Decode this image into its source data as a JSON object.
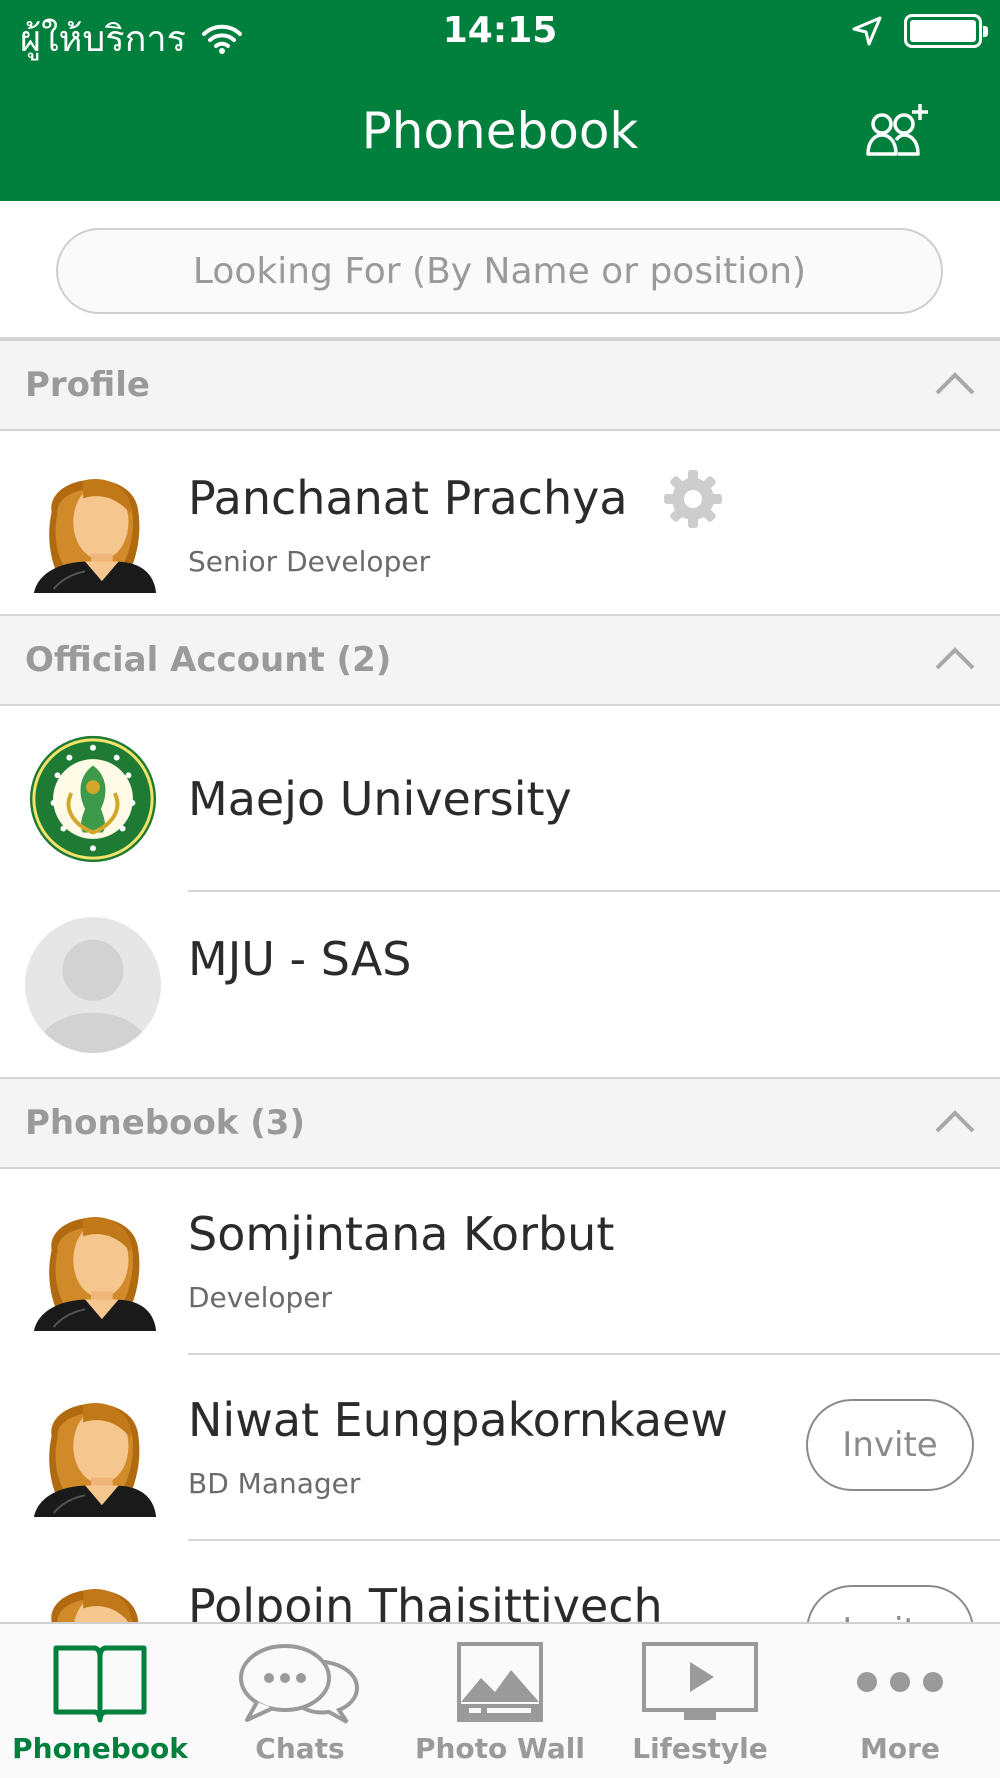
{
  "status_bar": {
    "carrier": "ผู้ให้บริการ",
    "time": "14:15"
  },
  "nav": {
    "title": "Phonebook",
    "add_contact_icon": "add-contact-icon"
  },
  "search": {
    "placeholder": "Looking For (By Name or position)"
  },
  "sections": {
    "profile": {
      "title": "Profile"
    },
    "official": {
      "title": "Official Account (2)"
    },
    "phonebook": {
      "title": "Phonebook (3)"
    }
  },
  "profile": {
    "name": "Panchanat Prachya",
    "position": "Senior Developer"
  },
  "official_accounts": [
    {
      "name": "Maejo University"
    },
    {
      "name": "MJU - SAS"
    }
  ],
  "contacts": [
    {
      "name": "Somjintana Korbut",
      "position": "Developer"
    },
    {
      "name": "Niwat Eungpakornkaew",
      "position": "BD Manager",
      "action": "Invite"
    },
    {
      "name": "Polpoin Thaisittivech",
      "action": "Invite"
    }
  ],
  "tabs": [
    {
      "label": "Phonebook",
      "icon": "book-icon",
      "active": true
    },
    {
      "label": "Chats",
      "icon": "chat-bubbles-icon"
    },
    {
      "label": "Photo Wall",
      "icon": "photo-icon"
    },
    {
      "label": "Lifestyle",
      "icon": "play-screen-icon"
    },
    {
      "label": "More",
      "icon": "more-dots-icon"
    }
  ],
  "colors": {
    "brand_green": "#017f3c",
    "section_bg": "#f4f4f4",
    "muted_text": "#9a9a9a"
  }
}
